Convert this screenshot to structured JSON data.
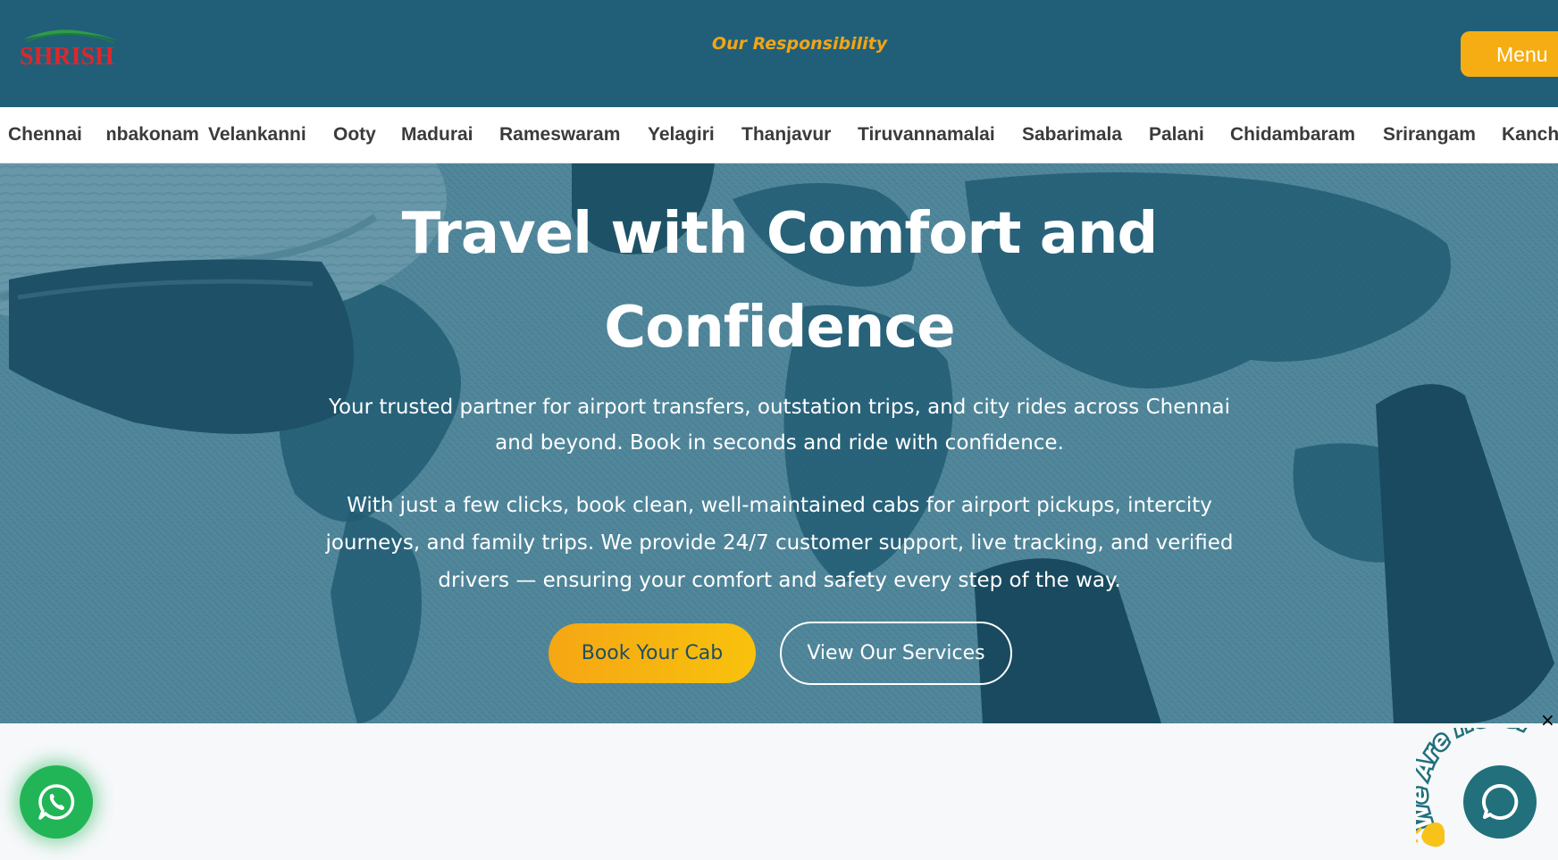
{
  "header": {
    "logo_text": "SHRISH",
    "responsibility_link": "Our Responsibility",
    "menu_label": "Menu"
  },
  "city_nav": {
    "items": [
      "Chennai",
      "Kumbakonam",
      "Velankanni",
      "Ooty",
      "Madurai",
      "Rameswaram",
      "Yelagiri",
      "Thanjavur",
      "Tiruvannamalai",
      "Sabarimala",
      "Palani",
      "Chidambaram",
      "Srirangam",
      "Kanchipuram"
    ]
  },
  "hero": {
    "title_line1": "Travel with Comfort and",
    "title_line2": "Confidence",
    "paragraph1": "Your trusted partner for airport transfers, outstation trips, and city rides across Chennai and beyond. Book in seconds and ride with confidence.",
    "paragraph2": "With just a few clicks, book clean, well-maintained cabs for airport pickups, intercity journeys, and family trips. We provide 24/7 customer support, live tracking, and verified drivers — ensuring your comfort and safety every step of the way.",
    "book_button": "Book Your Cab",
    "services_button": "View Our Services"
  },
  "widgets": {
    "close_symbol": "×",
    "chat_badge_text": "We Are Here!",
    "whatsapp_icon": "whatsapp-icon",
    "chat_icon": "chat-bubble-icon"
  },
  "colors": {
    "header_bg": "#215f78",
    "accent_yellow": "#f6ad13",
    "logo_red": "#e0262c",
    "whatsapp_green": "#22b557",
    "chat_teal": "#21707c"
  }
}
